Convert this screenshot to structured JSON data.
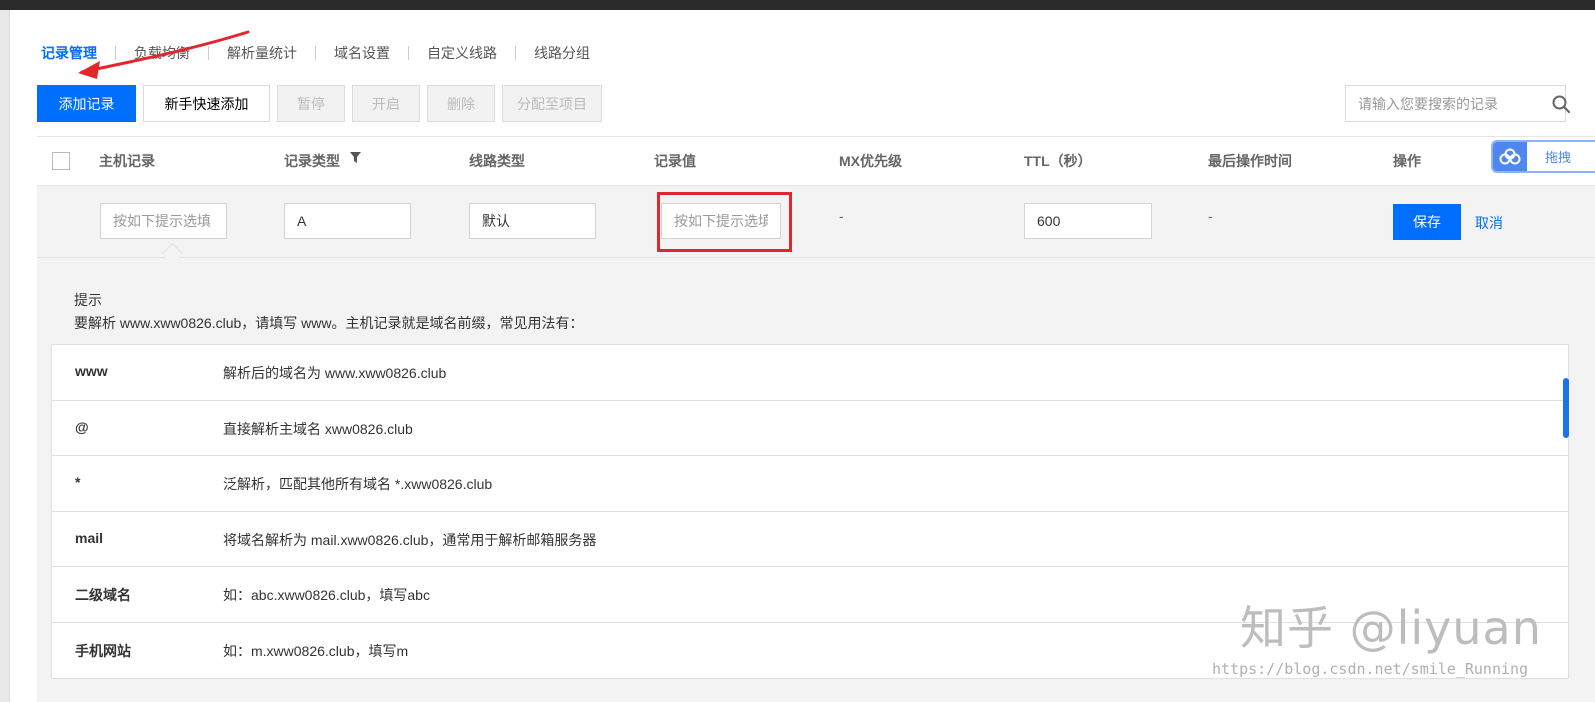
{
  "tabs": [
    {
      "label": "记录管理",
      "active": true
    },
    {
      "label": "负载均衡"
    },
    {
      "label": "解析量统计"
    },
    {
      "label": "域名设置"
    },
    {
      "label": "自定义线路"
    },
    {
      "label": "线路分组"
    }
  ],
  "toolbar": {
    "add_record": "添加记录",
    "quick_add": "新手快速添加",
    "pause": "暂停",
    "enable": "开启",
    "delete": "删除",
    "assign_project": "分配至项目"
  },
  "search": {
    "placeholder": "请输入您要搜索的记录",
    "icon": "search-icon"
  },
  "table": {
    "headers": {
      "host": "主机记录",
      "type": "记录类型",
      "line": "线路类型",
      "value": "记录值",
      "mx": "MX优先级",
      "ttl": "TTL（秒）",
      "last_op": "最后操作时间",
      "action": "操作"
    }
  },
  "edit_row": {
    "host_placeholder": "按如下提示选填",
    "type_value": "A",
    "line_value": "默认",
    "value_placeholder": "按如下提示选填",
    "mx": "-",
    "ttl_value": "600",
    "last_op": "-",
    "save": "保存",
    "cancel": "取消"
  },
  "badge": {
    "label": "拖拽",
    "icon": "cloud-icon"
  },
  "tips": {
    "title": "提示",
    "desc": "要解析 www.xww0826.club，请填写 www。主机记录就是域名前缀，常见用法有：",
    "rows": [
      {
        "key": "www",
        "val": "解析后的域名为 www.xww0826.club"
      },
      {
        "key": "@",
        "val": "直接解析主域名 xww0826.club"
      },
      {
        "key": "*",
        "val": "泛解析，匹配其他所有域名 *.xww0826.club"
      },
      {
        "key": "mail",
        "val": "将域名解析为 mail.xww0826.club，通常用于解析邮箱服务器"
      },
      {
        "key": "二级域名",
        "val": "如：abc.xww0826.club，填写abc"
      },
      {
        "key": "手机网站",
        "val": "如：m.xww0826.club，填写m"
      }
    ]
  },
  "watermark": {
    "main": "知乎 @liyuan",
    "url": "https://blog.csdn.net/smile_Running"
  },
  "colors": {
    "accent": "#006eff",
    "highlight": "#e3262d"
  }
}
